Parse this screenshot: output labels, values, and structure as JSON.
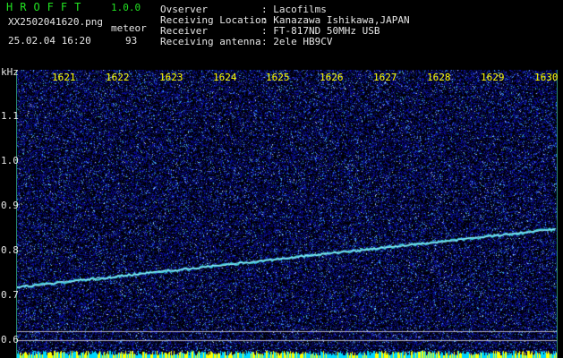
{
  "app": {
    "title": "HROFFT",
    "version": "1.0.0"
  },
  "file": {
    "name": "XX2502041620.png",
    "datetime": "25.02.04 16:20"
  },
  "detection": {
    "mode": "meteor",
    "count": "93"
  },
  "info": [
    {
      "label": "Ovserver",
      "value": ": Lacofilms"
    },
    {
      "label": "Receiving Location",
      "value": ": Kanazawa Ishikawa,JAPAN"
    },
    {
      "label": "Receiver",
      "value": ": FT-817ND 50MHz USB"
    },
    {
      "label": "Receiving antenna",
      "value": ": 2ele HB9CV"
    }
  ],
  "axis": {
    "unit": "kHz",
    "y_ticks": [
      "1.1",
      "1.0",
      "0.9",
      "0.8",
      "0.7",
      "0.6"
    ],
    "time_ticks": [
      "1621",
      "1622",
      "1623",
      "1624",
      "1625",
      "1626",
      "1627",
      "1628",
      "1629",
      "1630"
    ]
  },
  "colors": {
    "background": "#000000",
    "noise": "#1020b0",
    "trace": "#40d0e0",
    "yellow": "#ffff00",
    "green": "#22e222"
  }
}
